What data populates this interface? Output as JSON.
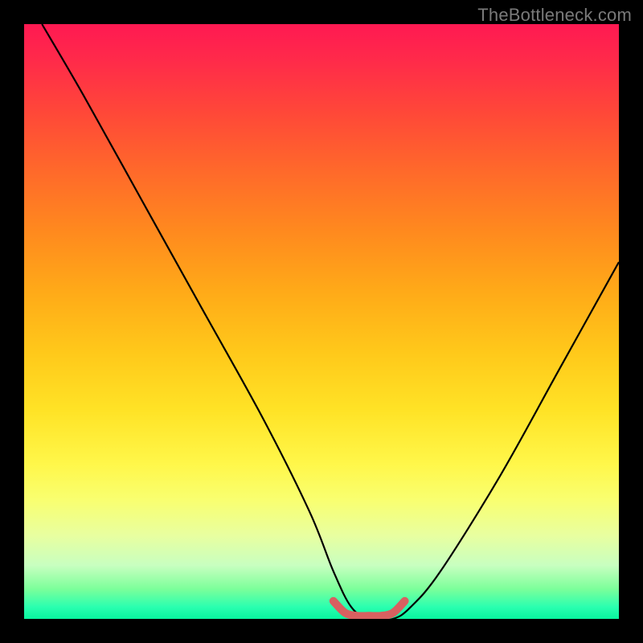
{
  "watermark": "TheBottleneck.com",
  "chart_data": {
    "type": "line",
    "title": "",
    "xlabel": "",
    "ylabel": "",
    "xlim": [
      0,
      100
    ],
    "ylim": [
      0,
      100
    ],
    "grid": false,
    "legend": false,
    "series": [
      {
        "name": "black-curve",
        "color": "#000000",
        "x": [
          3,
          10,
          20,
          30,
          40,
          48,
          52,
          55,
          58,
          62,
          65,
          70,
          80,
          90,
          100
        ],
        "y": [
          100,
          88,
          70,
          52,
          34,
          18,
          8,
          2,
          0,
          0,
          2,
          8,
          24,
          42,
          60
        ]
      },
      {
        "name": "red-flat-segment",
        "color": "#d86060",
        "x": [
          52,
          54,
          56,
          58,
          60,
          62,
          64
        ],
        "y": [
          3,
          1,
          0.5,
          0.5,
          0.5,
          1,
          3
        ]
      }
    ],
    "background_gradient": {
      "type": "vertical",
      "stops": [
        {
          "pos": 0.0,
          "color": "#ff1952"
        },
        {
          "pos": 0.5,
          "color": "#ffc81a"
        },
        {
          "pos": 0.78,
          "color": "#fff74a"
        },
        {
          "pos": 1.0,
          "color": "#08f59e"
        }
      ]
    }
  }
}
